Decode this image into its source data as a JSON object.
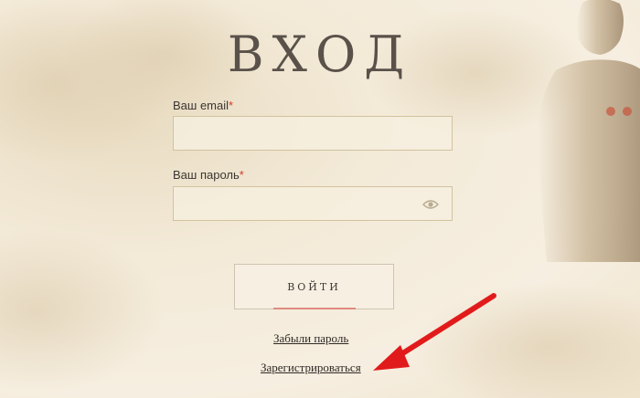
{
  "page": {
    "title": "ВХОД"
  },
  "form": {
    "email_label": "Ваш email",
    "password_label": "Ваш пароль",
    "required_mark": "*",
    "email_value": "",
    "password_value": "",
    "submit_label": "ВОЙТИ"
  },
  "links": {
    "forgot_password": "Забыли пароль",
    "register": "Зарегистрироваться"
  },
  "icons": {
    "password_toggle": "eye-icon",
    "annotation": "red-arrow"
  },
  "colors": {
    "background": "#f3ead8",
    "title": "#5a524a",
    "required": "#d23b2a",
    "field_border": "#d2c39e",
    "button_accent": "#e08b80",
    "annotation_arrow": "#e11b1b"
  }
}
